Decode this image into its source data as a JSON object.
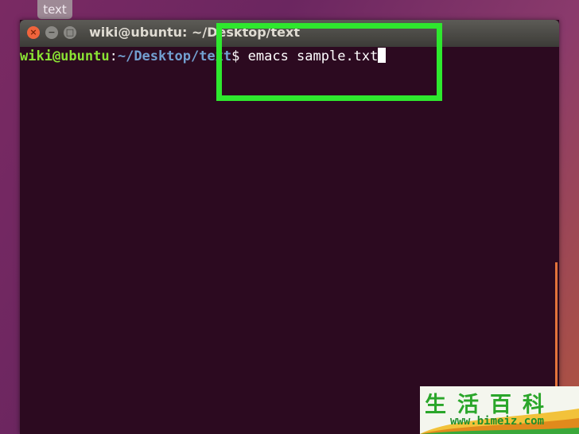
{
  "desktop": {
    "tab_label": "text"
  },
  "window": {
    "title": "wiki@ubuntu: ~/Desktop/text",
    "buttons": {
      "close": "×",
      "minimize": "−",
      "maximize": "□"
    }
  },
  "terminal": {
    "prompt_user": "wiki@ubuntu",
    "prompt_sep": ":",
    "prompt_path": "~/Desktop/text",
    "prompt_symbol": "$ ",
    "command": "emacs sample.txt"
  },
  "colors": {
    "highlight": "#2ee82e",
    "terminal_bg": "#2c0a20",
    "prompt_user": "#8ae234",
    "prompt_path": "#729fcf"
  },
  "watermark": {
    "chars": "生活百科",
    "url": "www.bimeiz.com"
  }
}
